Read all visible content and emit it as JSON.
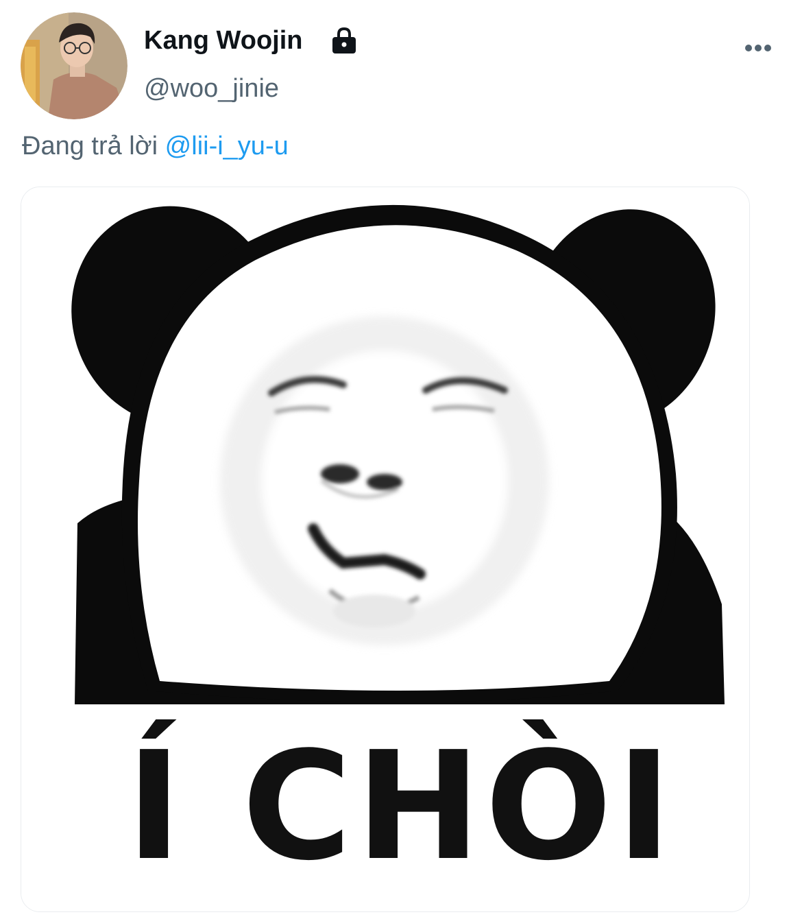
{
  "tweet": {
    "author": {
      "display_name": "Kang Woojin",
      "handle": "@woo_jinie",
      "protected_icon": "lock-icon",
      "avatar_icon": "profile-photo"
    },
    "menu_icon": "more-horizontal-icon",
    "reply_context": {
      "prefix": "Đang trả lời",
      "mention": "@lii-i_yu-u"
    },
    "media": {
      "type": "image",
      "description_icon": "panda-meme",
      "caption_text": "Í CHÒI"
    }
  },
  "colors": {
    "name": "#0f1419",
    "secondary_text": "#536471",
    "link": "#1d9bf0",
    "background": "#ffffff"
  }
}
